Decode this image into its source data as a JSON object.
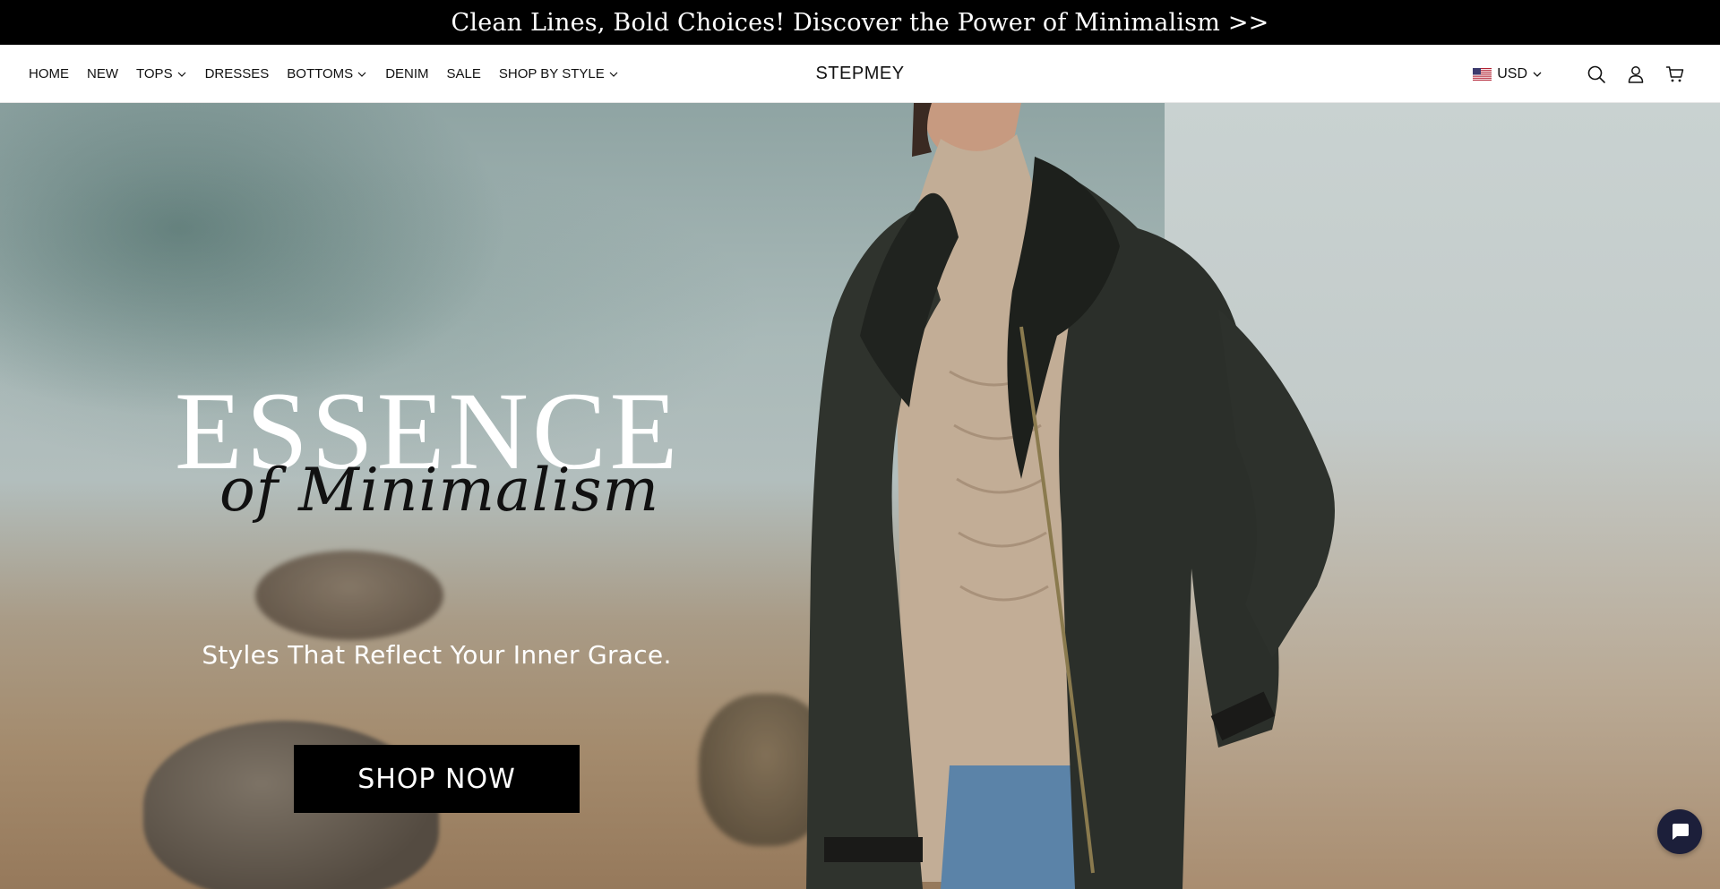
{
  "announcement": {
    "text": "Clean Lines, Bold Choices!  Discover the Power of Minimalism >>"
  },
  "nav": {
    "items": [
      {
        "label": "HOME",
        "has_dropdown": false
      },
      {
        "label": "NEW",
        "has_dropdown": false
      },
      {
        "label": "TOPS",
        "has_dropdown": true
      },
      {
        "label": "DRESSES",
        "has_dropdown": false
      },
      {
        "label": "BOTTOMS",
        "has_dropdown": true
      },
      {
        "label": "DENIM",
        "has_dropdown": false
      },
      {
        "label": "SALE",
        "has_dropdown": false
      },
      {
        "label": "SHOP BY STYLE",
        "has_dropdown": true
      }
    ]
  },
  "brand": {
    "name": "STEPMEY"
  },
  "header_right": {
    "currency": "USD",
    "flag_icon": "us-flag-icon",
    "icons": [
      "search-icon",
      "account-icon",
      "cart-icon"
    ]
  },
  "hero": {
    "title": "ESSENCE",
    "script": "of Minimalism",
    "subtitle": "Styles That Reflect Your Inner Grace.",
    "cta_label": "SHOP NOW"
  },
  "chat": {
    "icon": "chat-bubble-icon"
  },
  "colors": {
    "announcement_bg": "#000000",
    "cta_bg": "#000000",
    "chat_bg": "#1c1f3a"
  }
}
